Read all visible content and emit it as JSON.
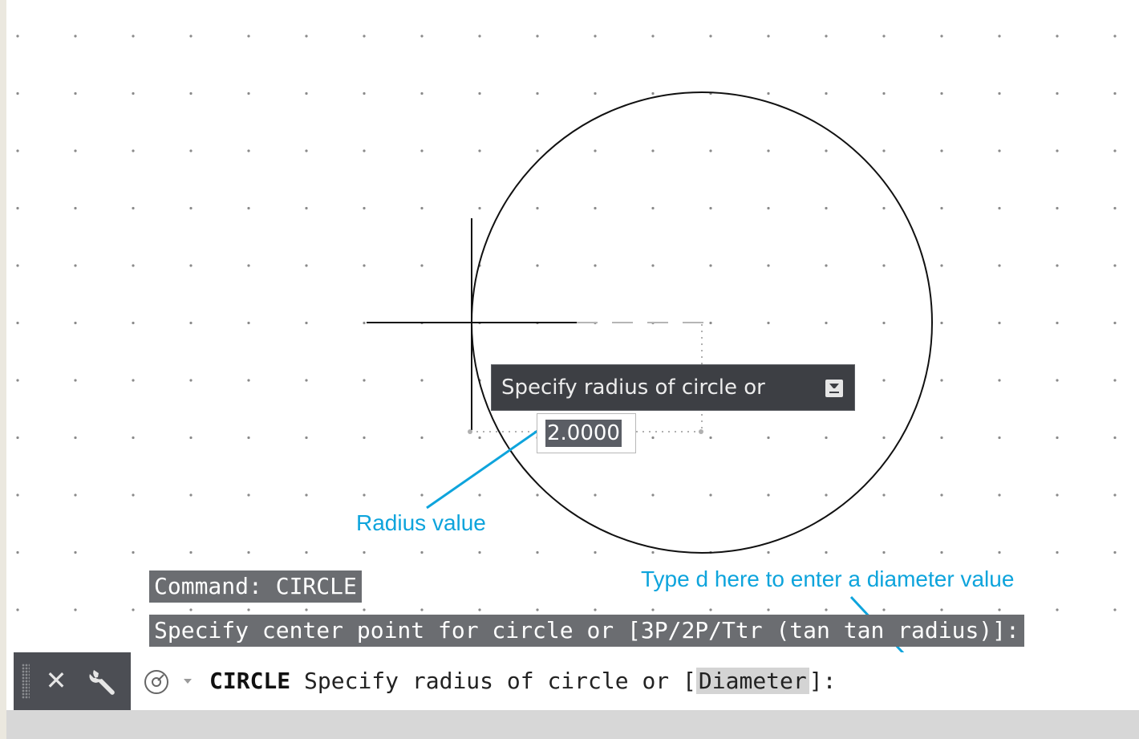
{
  "tooltip": {
    "prompt": "Specify radius of circle or"
  },
  "radius_input": {
    "value": "2.0000"
  },
  "annotations": {
    "radius": "Radius value",
    "diameter": "Type d here to enter a diameter value"
  },
  "history": {
    "line1": "Command: CIRCLE",
    "line2": "Specify center point for circle or [3P/2P/Ttr (tan tan radius)]:"
  },
  "command_line": {
    "command": "CIRCLE",
    "prompt": "Specify radius of circle or [",
    "option": "Diameter",
    "suffix": "]:"
  },
  "colors": {
    "annotation": "#0ea4dc",
    "tooltip_bg": "#3d3f44",
    "history_bg": "#6b6d71",
    "command_bar_bg": "#4c4e54"
  },
  "icons": [
    "close-icon",
    "wrench-icon",
    "command-prompt-icon",
    "dropdown-arrow-icon",
    "dropdown-icon"
  ]
}
